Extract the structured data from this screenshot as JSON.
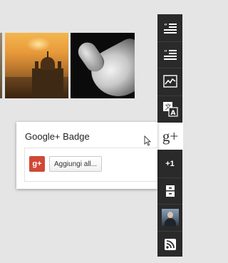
{
  "popup": {
    "title": "Google+ Badge",
    "badge_label": "g+",
    "add_button": "Aggiungi all..."
  },
  "toolbar": {
    "items": [
      {
        "icon": "quote-list-icon"
      },
      {
        "icon": "quote-list-alt-icon"
      },
      {
        "icon": "line-chart-icon"
      },
      {
        "icon": "translate-icon"
      },
      {
        "icon": "google-plus-icon",
        "label": "g+",
        "active": true
      },
      {
        "icon": "plus-one-icon",
        "label": "+1"
      },
      {
        "icon": "archive-icon"
      },
      {
        "icon": "avatar-icon"
      },
      {
        "icon": "rss-icon"
      }
    ]
  },
  "colors": {
    "toolbar_bg": "#2a2a2a",
    "background": "#e5e5e5",
    "gplus_red": "#d14836"
  }
}
